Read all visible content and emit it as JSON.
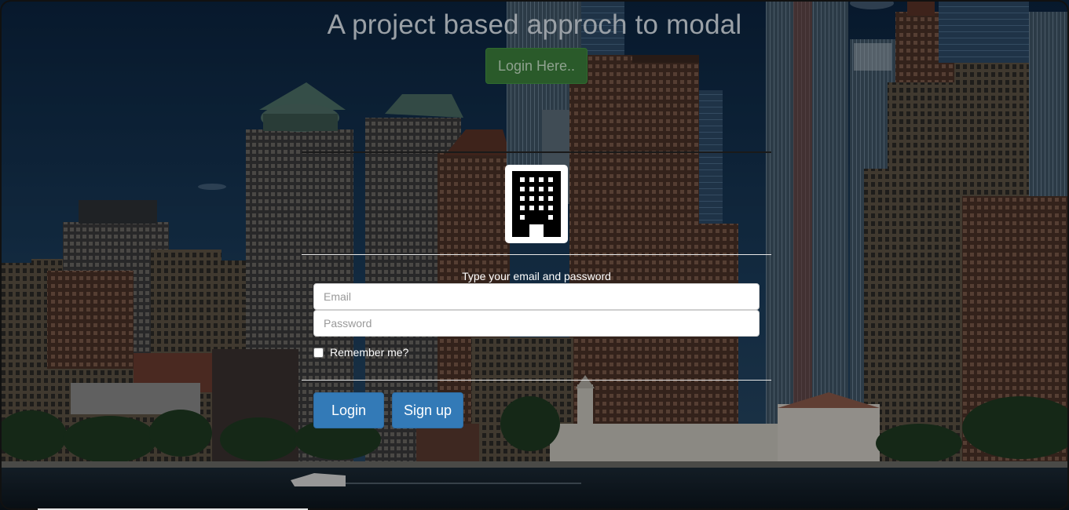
{
  "page": {
    "title": "A project based approch to modal",
    "open_modal_label": "Login Here.."
  },
  "modal": {
    "icon": "building-icon",
    "instructions": "Type your email and password",
    "email_placeholder": "Email",
    "password_placeholder": "Password",
    "remember_label": "Remember me?",
    "remember_checked": false,
    "login_label": "Login",
    "signup_label": "Sign up"
  },
  "colors": {
    "primary": "#337ab7",
    "open_button": "#2a5a2a",
    "title": "#9aa0a6"
  }
}
